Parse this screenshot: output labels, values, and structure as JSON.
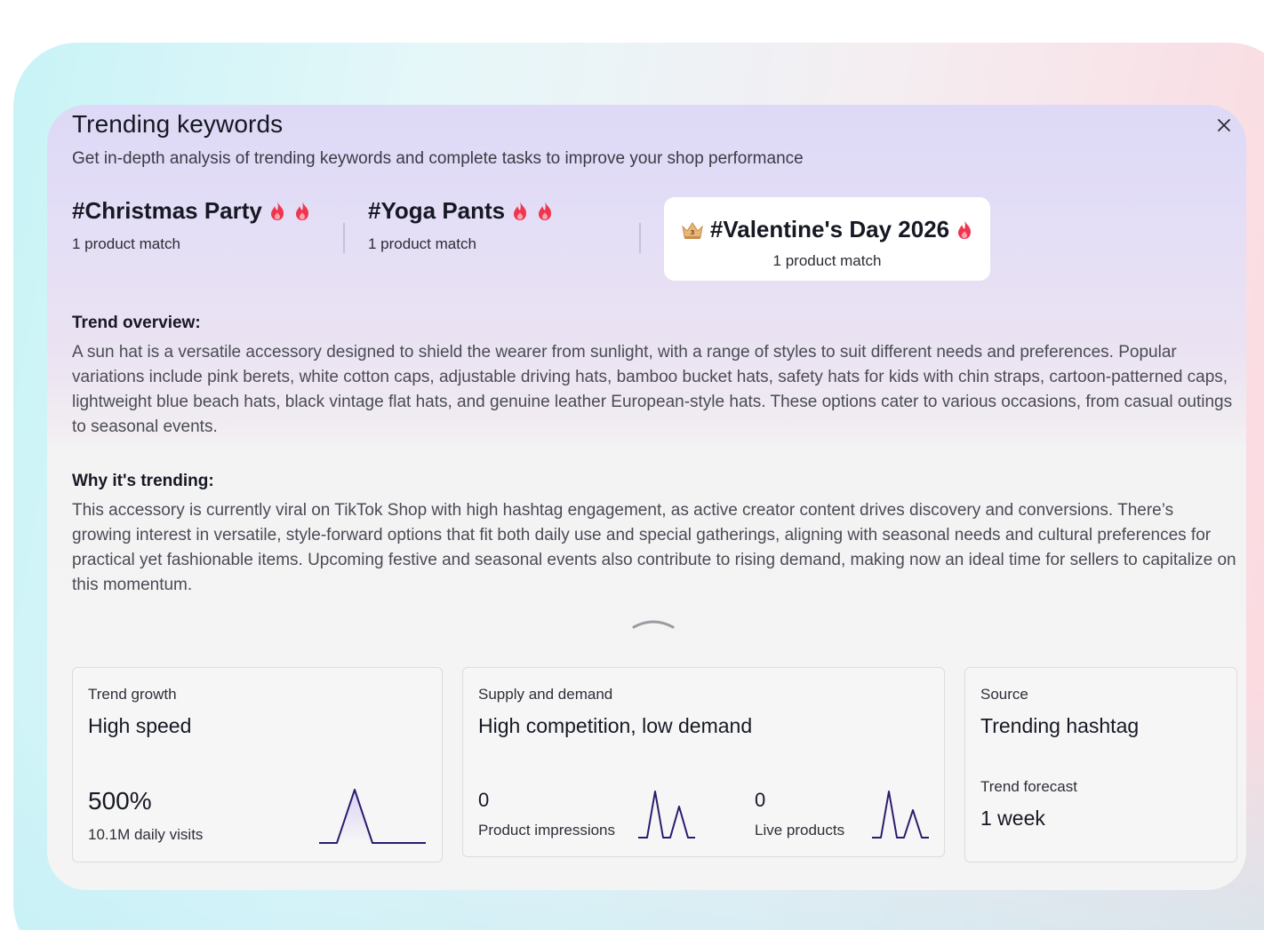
{
  "dialog": {
    "title": "Trending keywords",
    "subtitle": "Get in-depth analysis of trending keywords and complete tasks to improve your shop performance",
    "close_icon": "close-icon"
  },
  "keywords": [
    {
      "name": "#Christmas Party",
      "match": "1 product match",
      "fires": 2,
      "selected": false
    },
    {
      "name": "#Yoga Pants",
      "match": "1 product match",
      "fires": 2,
      "selected": false
    },
    {
      "name": "#Valentine's Day 2026",
      "match": "1 product match",
      "fires": 1,
      "selected": true,
      "rank_badge": "3"
    }
  ],
  "overview": {
    "heading": "Trend overview:",
    "text": "A sun hat is a versatile accessory designed to shield the wearer from sunlight, with a range of styles to suit different needs and preferences. Popular variations include pink berets, white cotton caps, adjustable driving hats, bamboo bucket hats, safety hats for kids with chin straps, cartoon-patterned caps, lightweight blue beach hats, black vintage flat hats, and genuine leather European-style hats. These options cater to various occasions, from casual outings to seasonal events."
  },
  "why": {
    "heading": "Why it's trending:",
    "text": "This accessory is currently viral on TikTok Shop with high hashtag engagement, as active creator content drives discovery and conversions. There’s growing interest in versatile, style-forward options that fit both daily use and special gatherings, aligning with seasonal needs and cultural preferences for practical yet fashionable items. Upcoming festive and seasonal events also contribute to rising demand, making now an ideal time for sellers to capitalize on this momentum."
  },
  "cards": {
    "growth": {
      "label": "Trend growth",
      "value": "High speed",
      "metric": "500%",
      "metric_sub": "10.1M daily visits"
    },
    "supply": {
      "label": "Supply and demand",
      "value": "High competition, low demand",
      "impressions": "0",
      "impressions_label": "Product impressions",
      "live": "0",
      "live_label": "Live products"
    },
    "source": {
      "label": "Source",
      "value": "Trending hashtag",
      "forecast_label": "Trend forecast",
      "forecast_value": "1 week"
    }
  },
  "colors": {
    "accent": "#2d1a6e",
    "fire": "#fe2c55",
    "selected_bg": "#ffffff"
  }
}
